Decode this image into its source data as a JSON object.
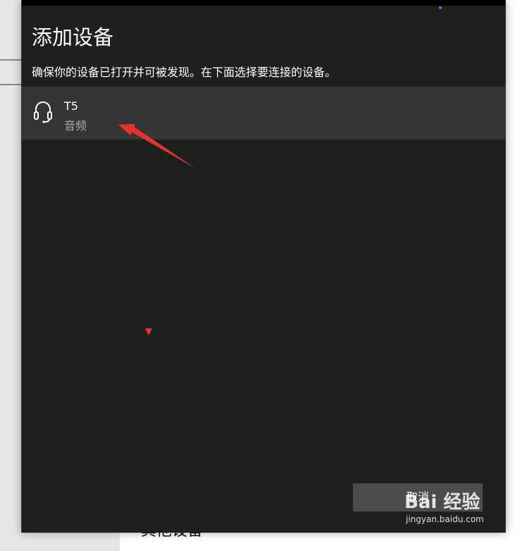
{
  "background": {
    "section_heading": "其他设备"
  },
  "dialog": {
    "title": "添加设备",
    "description": "确保你的设备已打开并可被发现。在下面选择要连接的设备。",
    "devices": [
      {
        "name": "T5",
        "type": "音频",
        "icon": "headset-icon"
      }
    ],
    "cancel_label": "取消"
  },
  "watermark": {
    "logo": "Bai 经验",
    "url": "jingyan.baidu.com"
  },
  "colors": {
    "dialog_bg": "#1f1f1f",
    "selected_item_bg": "#353535",
    "button_bg": "#4c4c4c",
    "annotation_red": "#e8322c",
    "accent_blue": "#2d8cf0"
  }
}
